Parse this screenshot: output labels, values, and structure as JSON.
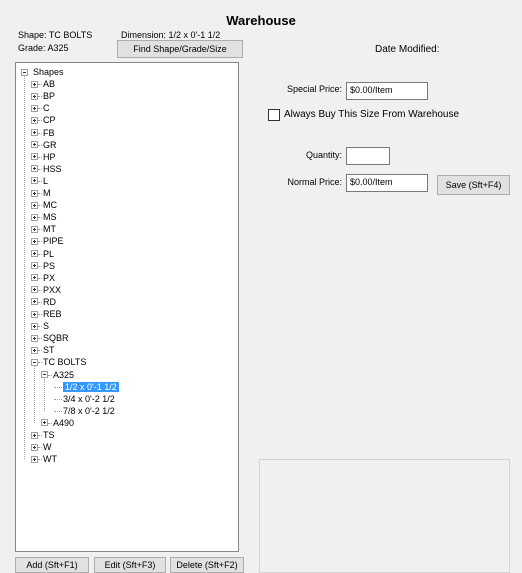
{
  "window": {
    "title": "Warehouse"
  },
  "info": {
    "shape_label": "Shape:",
    "shape_value": "TC BOLTS",
    "dimension_label": "Dimension:",
    "dimension_value": "1/2 x 0'-1 1/2",
    "grade_label": "Grade:",
    "grade_value": "A325"
  },
  "find_button": "Find Shape/Grade/Size",
  "date_modified_label": "Date Modified:",
  "tree": {
    "root": "Shapes",
    "items": [
      "AB",
      "BP",
      "C",
      "CP",
      "FB",
      "GR",
      "HP",
      "HSS",
      "L",
      "M",
      "MC",
      "MS",
      "MT",
      "PIPE",
      "PL",
      "PS",
      "PX",
      "PXX",
      "RD",
      "REB",
      "S",
      "SQBR",
      "ST"
    ],
    "expanded": "TC BOLTS",
    "grade": "A325",
    "sizes": [
      "1/2 x 0'-1 1/2",
      "3/4 x 0'-2 1/2",
      "7/8 x 0'-2 1/2"
    ],
    "grade2": "A490",
    "items_after": [
      "TS",
      "W",
      "WT"
    ]
  },
  "form": {
    "special_price_label": "Special Price:",
    "special_price_value": "$0.00/Item",
    "always_buy_label": "Always Buy This Size From Warehouse",
    "quantity_label": "Quantity:",
    "quantity_value": "",
    "normal_price_label": "Normal Price:",
    "normal_price_value": "$0.00/Item",
    "save_button": "Save (Sft+F4)"
  },
  "buttons": {
    "add": "Add (Sft+F1)",
    "edit": "Edit (Sft+F3)",
    "delete": "Delete (Sft+F2)"
  }
}
